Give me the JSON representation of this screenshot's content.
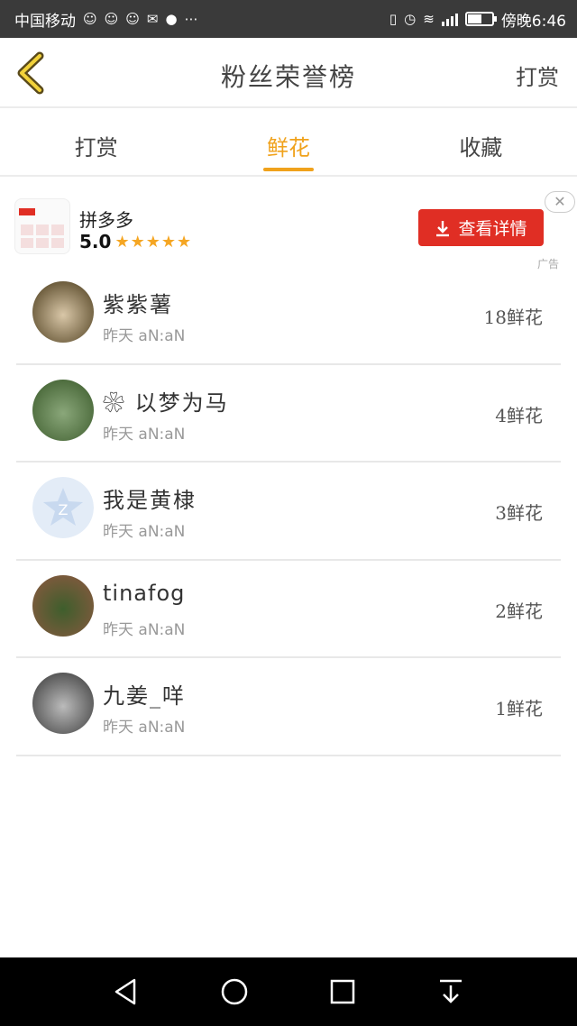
{
  "status_bar": {
    "carrier": "中国移动",
    "time_label": "傍晚6:46",
    "battery_level": 0.6
  },
  "header": {
    "title": "粉丝荣誉榜",
    "action": "打赏"
  },
  "tabs": [
    {
      "label": "打赏",
      "active": false
    },
    {
      "label": "鲜花",
      "active": true
    },
    {
      "label": "收藏",
      "active": false
    }
  ],
  "ad": {
    "app_name": "拼多多",
    "rating": "5.0",
    "stars": "★★★★★",
    "button_label": "查看详情",
    "close_symbol": "✕",
    "tag": "广告",
    "brand_color": "#e02e24"
  },
  "fans": [
    {
      "name": "紫紫薯",
      "time": "昨天 aN:aN",
      "count": "18鲜花",
      "avatar_colors": [
        "#6a5a3a",
        "#d9c7a8"
      ]
    },
    {
      "name": "❀ 以梦为马",
      "time": "昨天 aN:aN",
      "count": "4鲜花",
      "avatar_colors": [
        "#4c6b3c",
        "#8aa77a"
      ]
    },
    {
      "name": "我是黄棣",
      "time": "昨天 aN:aN",
      "count": "3鲜花",
      "avatar_colors": [
        "#dbe7f5",
        "#b5cbea"
      ]
    },
    {
      "name": "tinafog",
      "time": "昨天 aN:aN",
      "count": "2鲜花",
      "avatar_colors": [
        "#7b5a3c",
        "#3e5e2c"
      ]
    },
    {
      "name": "九姜_咩",
      "time": "昨天 aN:aN",
      "count": "1鲜花",
      "avatar_colors": [
        "#555555",
        "#bbbbbb"
      ]
    }
  ],
  "accent_color": "#f0a21c"
}
